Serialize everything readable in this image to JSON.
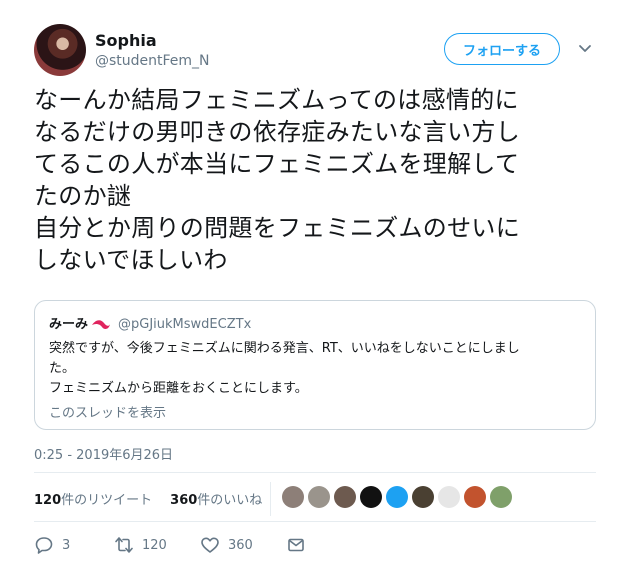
{
  "header": {
    "display_name": "Sophia",
    "handle": "@studentFem_N",
    "follow_label": "フォローする"
  },
  "tweet": {
    "text": "なーんか結局フェミニズムってのは感情的に\nなるだけの男叩きの依存症みたいな言い方し\nてるこの人が本当にフェミニズムを理解して\nたのか謎\n自分とか周りの問題をフェミニズムのせいに\nしないでほしいわ",
    "timestamp": "0:25 - 2019年6月26日"
  },
  "quote": {
    "name": "みーみ",
    "handle": "@pGJiukMswdECZTx",
    "text": "突然ですが、今後フェミニズムに関わる発言、RT、いいねをしないことにしまし\nた。\nフェミニズムから距離をおくことにします。",
    "thread_link": "このスレッドを表示"
  },
  "stats": {
    "retweets_count": "120",
    "retweets_label": "件のリツイート",
    "likes_count": "360",
    "likes_label": "件のいいね"
  },
  "liker_avatars": [
    {
      "color": "#8d7f78"
    },
    {
      "color": "#9a948c"
    },
    {
      "color": "#6d5a4f"
    },
    {
      "color": "#111111"
    },
    {
      "color": "#1da1f2"
    },
    {
      "color": "#4a4032"
    },
    {
      "color": "#e6e6e6"
    },
    {
      "color": "#c2532e"
    },
    {
      "color": "#7fa06a"
    }
  ],
  "actions": {
    "reply_count": "3",
    "retweet_count": "120",
    "like_count": "360"
  },
  "icons": {
    "caret": "chevron-down-icon",
    "reply": "reply-icon",
    "retweet": "retweet-icon",
    "like": "heart-icon",
    "dm": "envelope-icon"
  }
}
